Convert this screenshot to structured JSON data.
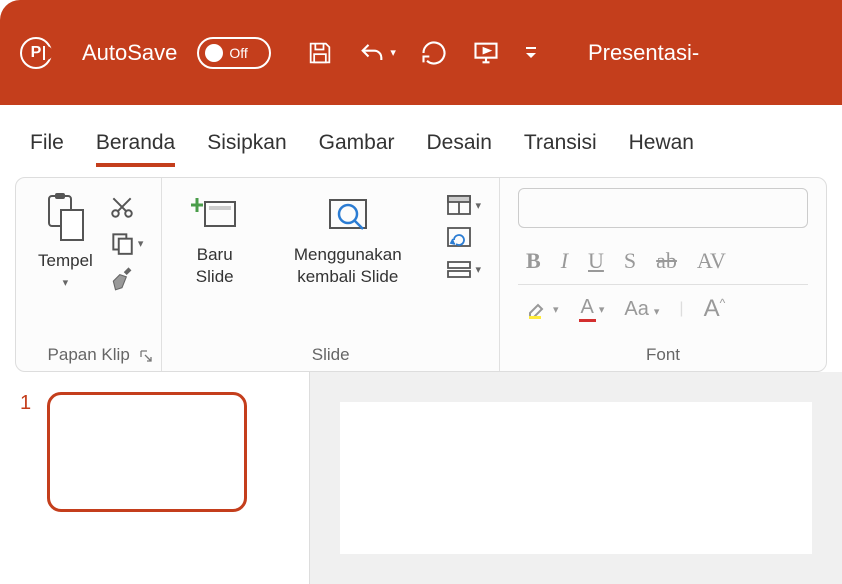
{
  "title_bar": {
    "autosave_label": "AutoSave",
    "autosave_state": "Off",
    "document_name": "Presentasi-"
  },
  "tabs": {
    "file": "File",
    "home": "Beranda",
    "insert": "Sisipkan",
    "draw": "Gambar",
    "design": "Desain",
    "transitions": "Transisi",
    "animations": "Hewan"
  },
  "ribbon": {
    "clipboard": {
      "paste": "Tempel",
      "group_label": "Papan Klip"
    },
    "slides": {
      "new_slide": "Baru Slide",
      "reuse_slides": "Menggunakan kembali Slide",
      "group_label": "Slide"
    },
    "font": {
      "group_label": "Font",
      "bold": "B",
      "italic": "I",
      "underline": "U",
      "shadow": "S",
      "strike": "ab",
      "av": "AV",
      "case": "Aa",
      "size_up": "A"
    }
  },
  "thumbnails": {
    "slide1_num": "1"
  }
}
